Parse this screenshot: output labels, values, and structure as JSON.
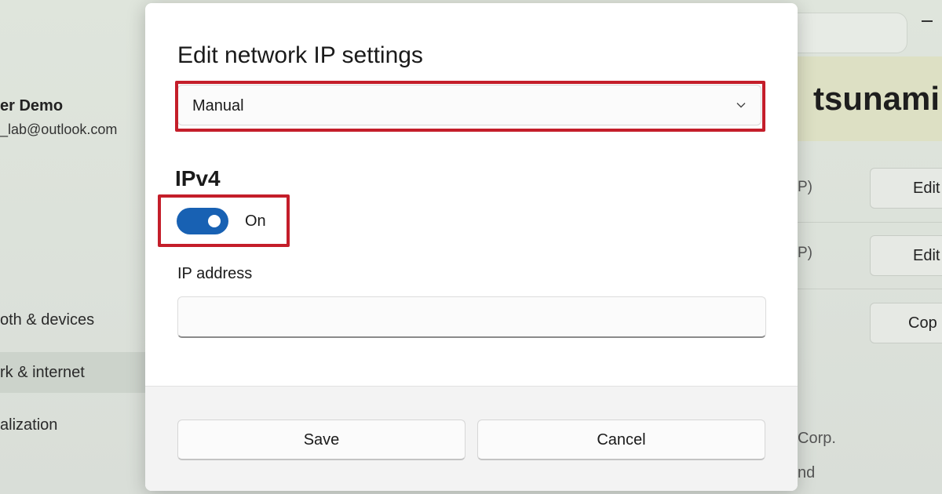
{
  "background": {
    "account": {
      "name": "er Demo",
      "email": "_lab@outlook.com"
    },
    "nav_items": [
      {
        "label": "oth & devices",
        "selected": false
      },
      {
        "label": "rk & internet",
        "selected": true
      },
      {
        "label": "alization",
        "selected": false
      }
    ],
    "page_title": "tsunami",
    "rows": [
      {
        "text": "P)",
        "button": "Edit"
      },
      {
        "text": "P)",
        "button": "Edit"
      },
      {
        "text": "",
        "button": "Cop"
      }
    ],
    "footer_texts": [
      "Corp.",
      "nd"
    ]
  },
  "dialog": {
    "title": "Edit network IP settings",
    "mode_select": {
      "value": "Manual",
      "icon": "chevron-down-icon"
    },
    "ipv4": {
      "heading": "IPv4",
      "toggle_state": "On",
      "toggle_on": true
    },
    "ip_address": {
      "label": "IP address",
      "value": "",
      "placeholder": ""
    },
    "buttons": {
      "save": "Save",
      "cancel": "Cancel"
    }
  },
  "colors": {
    "highlight": "#c41e2a",
    "toggle_on": "#1861b3",
    "dialog_bg": "#ffffff",
    "footer_bg": "#f3f3f3"
  }
}
